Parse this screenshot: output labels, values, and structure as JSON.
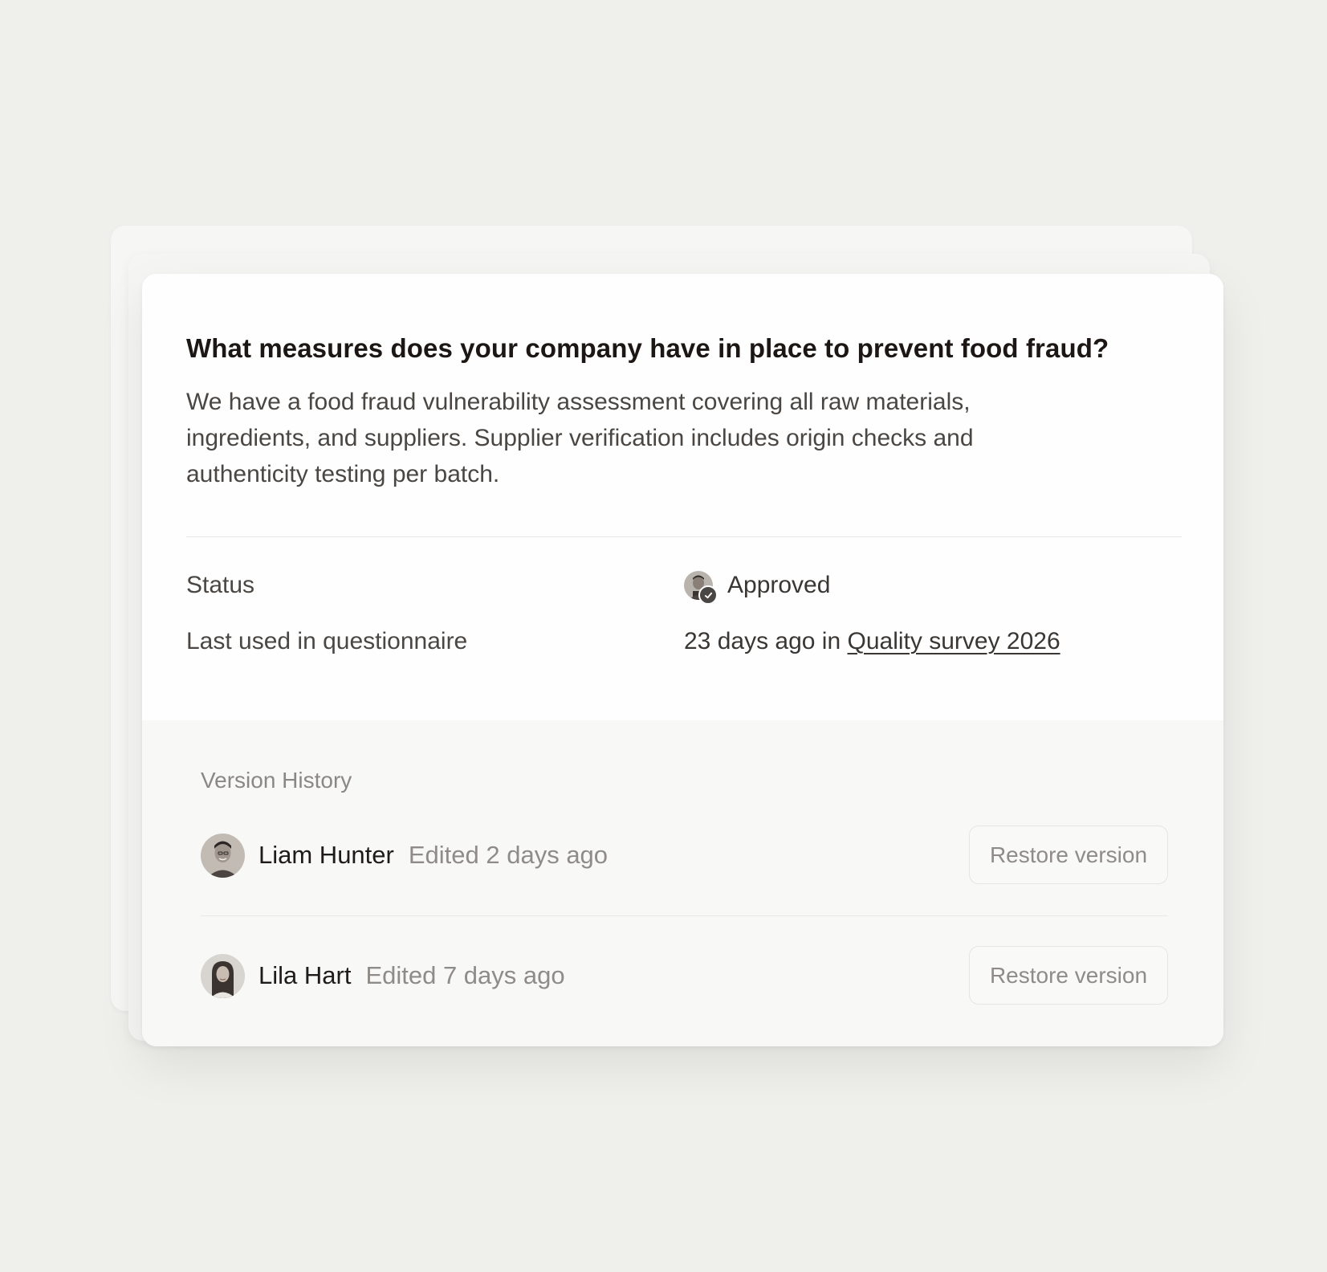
{
  "question": {
    "title": "What measures does your company have in place to prevent food fraud?",
    "answer": "We have a food fraud vulnerability assessment covering all raw materials, ingredients, and suppliers. Supplier verification includes origin checks and authenticity testing per batch."
  },
  "meta": {
    "status_label": "Status",
    "status_value": "Approved",
    "last_used_label": "Last used in questionnaire",
    "last_used_prefix": "23 days ago in",
    "last_used_link": "Quality survey 2026"
  },
  "version_history": {
    "title": "Version History",
    "entries": [
      {
        "name": "Liam Hunter",
        "edited": "Edited 2 days ago",
        "restore_label": "Restore version"
      },
      {
        "name": "Lila Hart",
        "edited": "Edited 7 days ago",
        "restore_label": "Restore version"
      }
    ]
  },
  "colors": {
    "background": "#efefeb",
    "card": "#ffffff",
    "history_panel": "#f8f8f7",
    "heading_text": "#1c1715",
    "muted_text": "#8f8b88"
  }
}
